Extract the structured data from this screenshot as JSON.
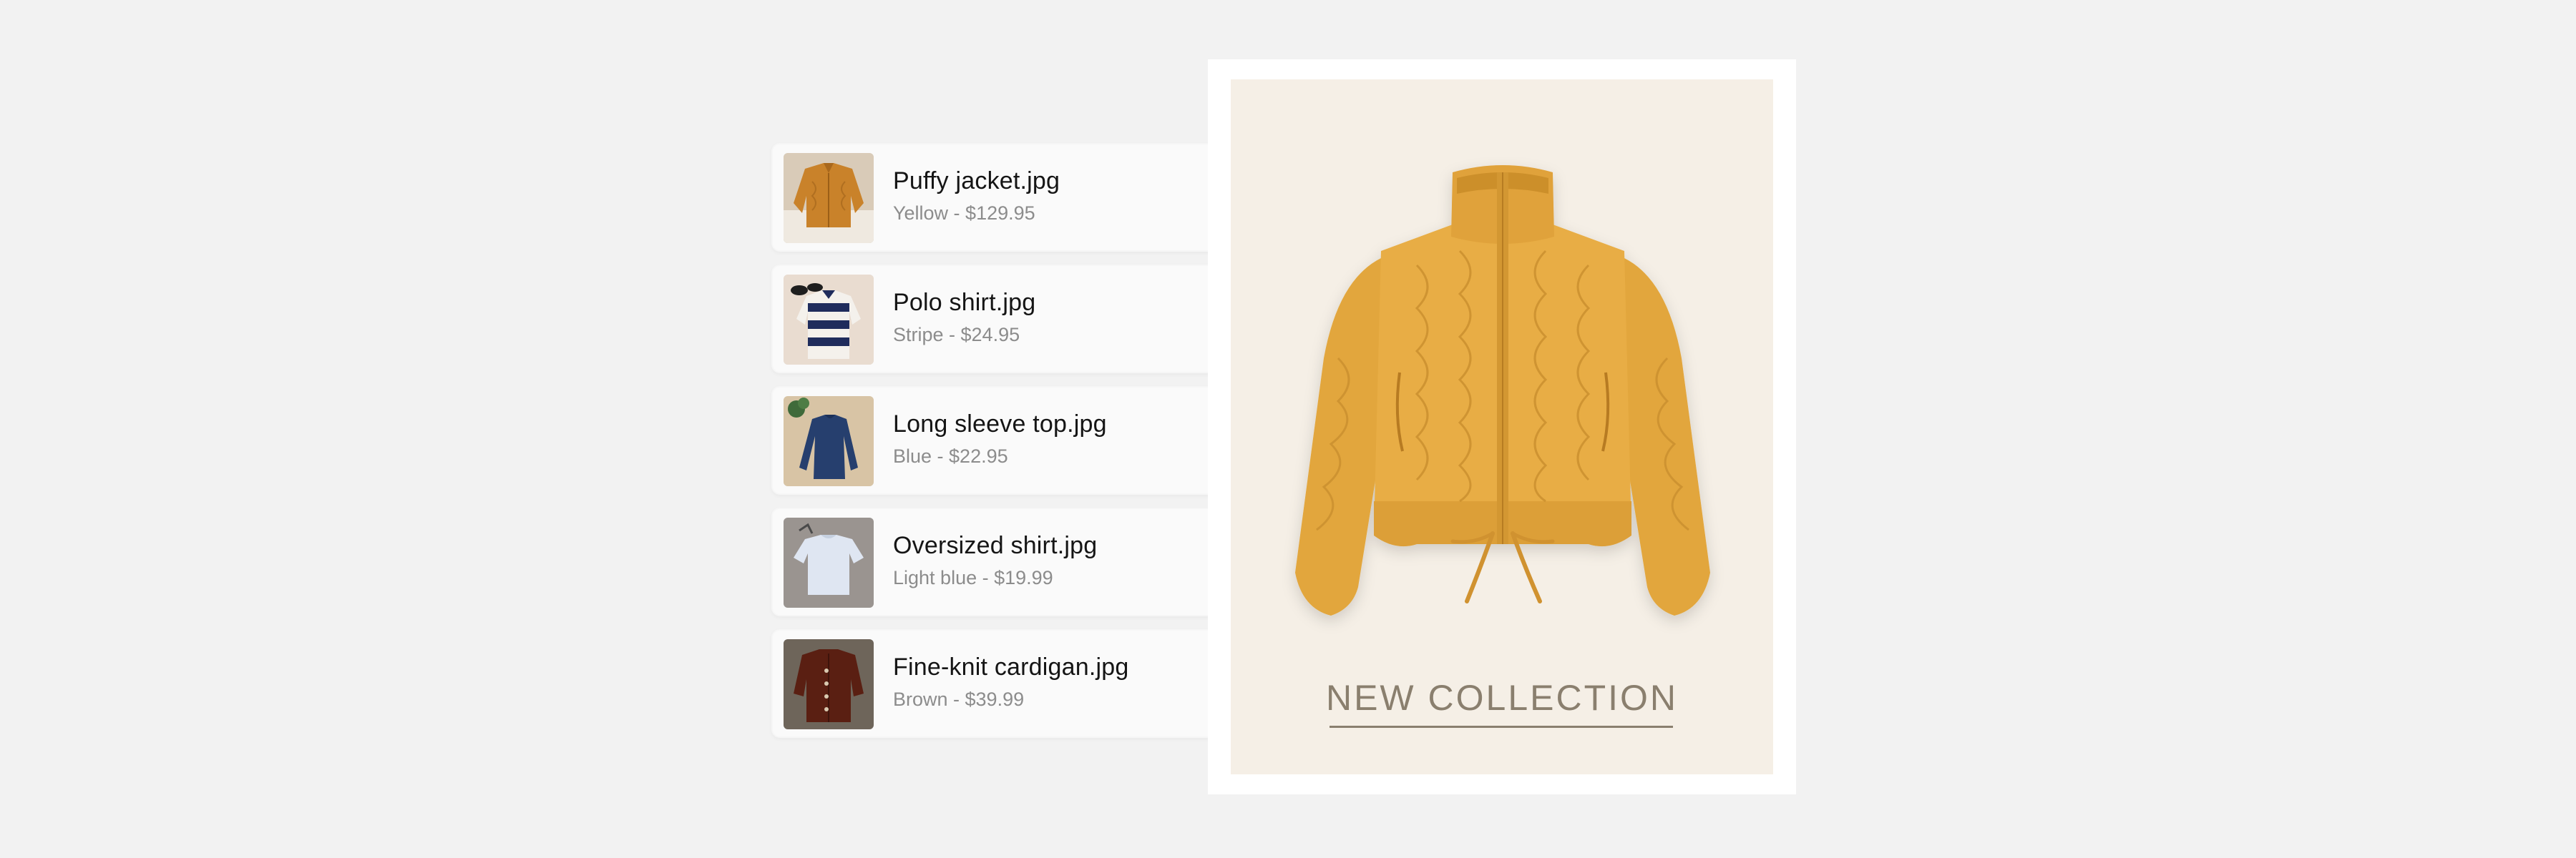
{
  "files": [
    {
      "name": "Puffy jacket.jpg",
      "meta": "Yellow - $129.95",
      "thumb_icon": "yellow-jacket-thumbnail"
    },
    {
      "name": "Polo shirt.jpg",
      "meta": "Stripe - $24.95",
      "thumb_icon": "striped-shirt-thumbnail"
    },
    {
      "name": "Long sleeve top.jpg",
      "meta": "Blue - $22.95",
      "thumb_icon": "blue-top-thumbnail"
    },
    {
      "name": "Oversized shirt.jpg",
      "meta": "Light blue - $19.99",
      "thumb_icon": "light-blue-shirt-thumbnail"
    },
    {
      "name": "Fine-knit cardigan.jpg",
      "meta": "Brown - $39.99",
      "thumb_icon": "brown-cardigan-thumbnail"
    }
  ],
  "preview": {
    "title": "NEW COLLECTION",
    "image_icon": "yellow-puffy-jacket-image"
  },
  "colors": {
    "background": "#f2f2f2",
    "card": "#fafafa",
    "preview_backdrop": "#f5efe6",
    "jacket": "#e2a63c",
    "title_text": "#8a7f6e"
  }
}
